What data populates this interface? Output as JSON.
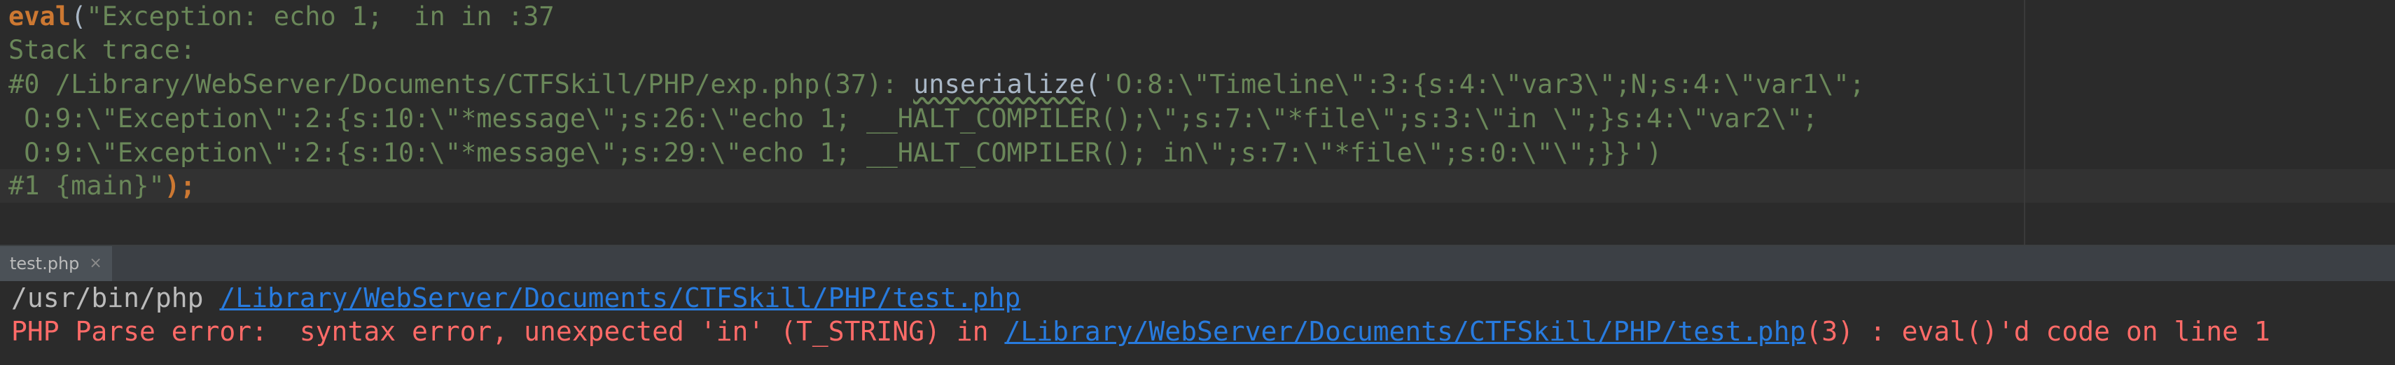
{
  "editor": {
    "line1": {
      "keyword": "eval",
      "paren": "(",
      "text": "\"Exception: echo 1;  in in :37"
    },
    "line2": "Stack trace:",
    "line3": {
      "prefix": "#0 /Library/WebServer/Documents/CTFSkill/PHP/exp.php(37): ",
      "function": "unserialize",
      "paren": "(",
      "arg": "'O:8:\\\"Timeline\\\":3:{s:4:\\\"var3\\\";N;s:4:\\\"var1\\\";"
    },
    "line4": " O:9:\\\"Exception\\\":2:{s:10:\\\"*message\\\";s:26:\\\"echo 1; __HALT_COMPILER();\\\";s:7:\\\"*file\\\";s:3:\\\"in \\\";}s:4:\\\"var2\\\";",
    "line5": " O:9:\\\"Exception\\\":2:{s:10:\\\"*message\\\";s:29:\\\"echo 1; __HALT_COMPILER(); in\\\";s:7:\\\"*file\\\";s:0:\\\"\\\";}}')",
    "line6": {
      "text": "#1 {main}\"",
      "close": ");"
    }
  },
  "run_panel": {
    "tab_label": "test.php",
    "tab_close": "×"
  },
  "console": {
    "line1_prefix": "/usr/bin/php ",
    "line1_link": "/Library/WebServer/Documents/CTFSkill/PHP/test.php",
    "line2_prefix": "PHP Parse error:  syntax error, unexpected 'in' (T_STRING) in ",
    "line2_link": "/Library/WebServer/Documents/CTFSkill/PHP/test.php",
    "line2_suffix": "(3) : eval()'d code on line 1"
  },
  "colors": {
    "background": "#2b2b2b",
    "string": "#6a8759",
    "keyword": "#cc7832",
    "error": "#ff6b68",
    "link": "#287bde"
  }
}
